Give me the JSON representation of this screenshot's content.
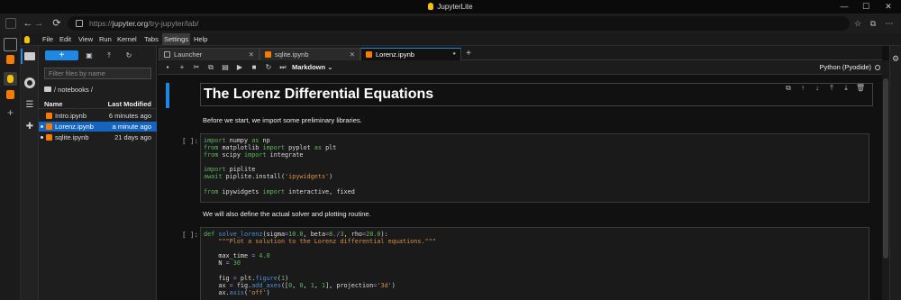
{
  "window": {
    "title": "JupyterLite",
    "controls": [
      "—",
      "☐",
      "✕"
    ]
  },
  "browser": {
    "url_prefix": "https://",
    "url_host": "jupyter.org",
    "url_path": "/try-jupyter/lab/",
    "back": "←",
    "forward": "→",
    "reload": "⟳"
  },
  "menu": {
    "items": [
      "File",
      "Edit",
      "View",
      "Run",
      "Kernel",
      "Tabs",
      "Settings",
      "Help"
    ],
    "active": "Settings"
  },
  "filebrowser": {
    "new_label": "+",
    "filter_placeholder": "Filter files by name",
    "breadcrumb": "/ notebooks /",
    "col_name": "Name",
    "col_modified": "Last Modified",
    "files": [
      {
        "name": "Intro.ipynb",
        "modified": "6 minutes ago",
        "selected": false,
        "running": false
      },
      {
        "name": "Lorenz.ipynb",
        "modified": "a minute ago",
        "selected": true,
        "running": true
      },
      {
        "name": "sqlite.ipynb",
        "modified": "21 days ago",
        "selected": false,
        "running": true
      }
    ]
  },
  "tabs": [
    {
      "label": "Launcher",
      "active": false,
      "close": "✕"
    },
    {
      "label": "sqlite.ipynb",
      "active": false,
      "close": "✕"
    },
    {
      "label": "Lorenz.ipynb",
      "active": true,
      "close": "●"
    }
  ],
  "toolbar": {
    "cell_type": "Markdown",
    "kernel": "Python (Pyodide)"
  },
  "notebook": {
    "heading": "The Lorenz Differential Equations",
    "text1": "Before we start, we import some preliminary libraries.",
    "prompt1": "[ ]:",
    "text2": "We will also define the actual solver and plotting routine.",
    "prompt2": "[ ]:"
  },
  "colors": {
    "accent": "#1e88e5",
    "notebook_icon": "#f57c00",
    "jupyter_yellow": "#f5c400"
  }
}
